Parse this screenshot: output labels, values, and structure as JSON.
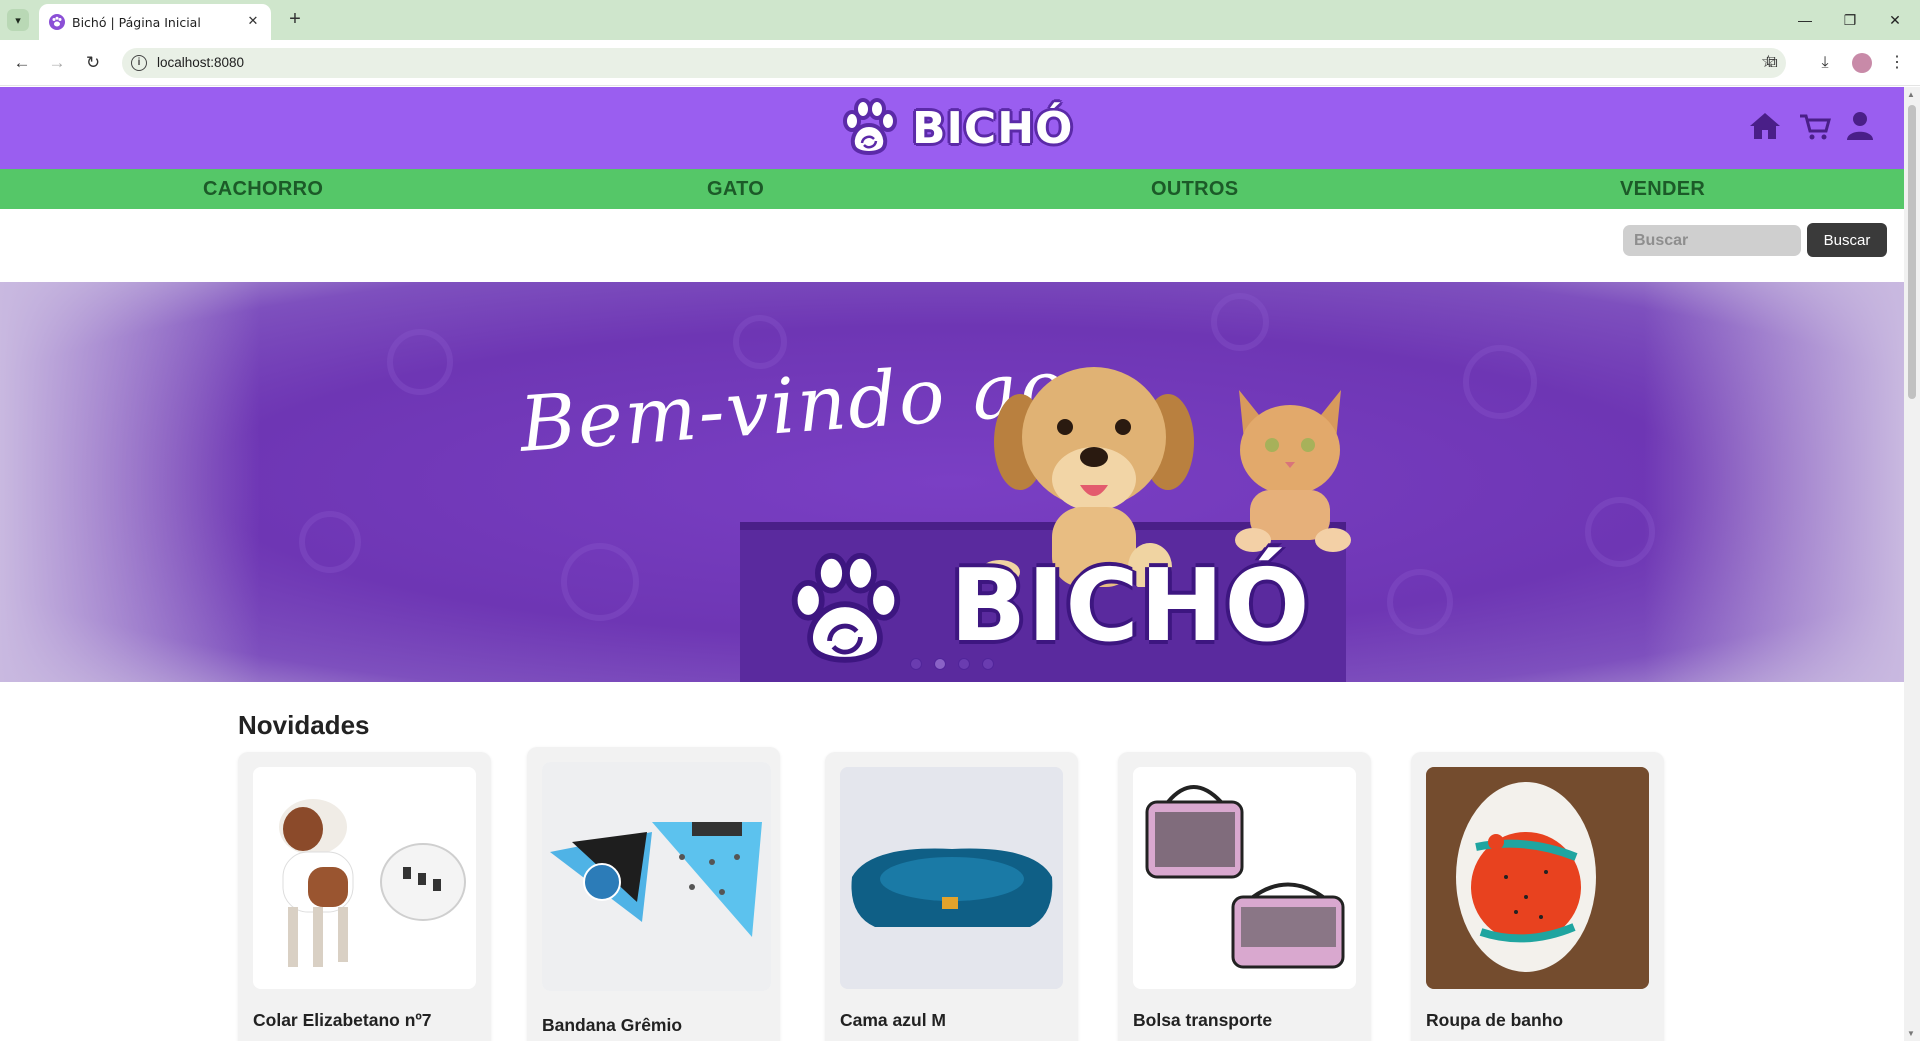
{
  "browser": {
    "tab_title": "Bichó | Página Inicial",
    "url": "localhost:8080"
  },
  "site": {
    "logo_text": "BICHÓ",
    "brand_color": "#9a5ef0",
    "nav_color": "#55c768",
    "categories": [
      "CACHORRO",
      "GATO",
      "OUTROS",
      "VENDER"
    ],
    "header_icons": [
      "home-icon",
      "cart-icon",
      "user-icon"
    ],
    "search": {
      "placeholder": "Buscar",
      "button_label": "Buscar"
    }
  },
  "hero": {
    "script_text": "Bem-vindo ao",
    "brand_text": "BICHÓ",
    "slides": 4,
    "active_slide": 2
  },
  "news": {
    "title": "Novidades",
    "products": [
      {
        "name": "Colar Elizabetano nº7"
      },
      {
        "name": "Bandana Grêmio"
      },
      {
        "name": "Cama azul M"
      },
      {
        "name": "Bolsa transporte"
      },
      {
        "name": "Roupa de banho"
      }
    ]
  }
}
